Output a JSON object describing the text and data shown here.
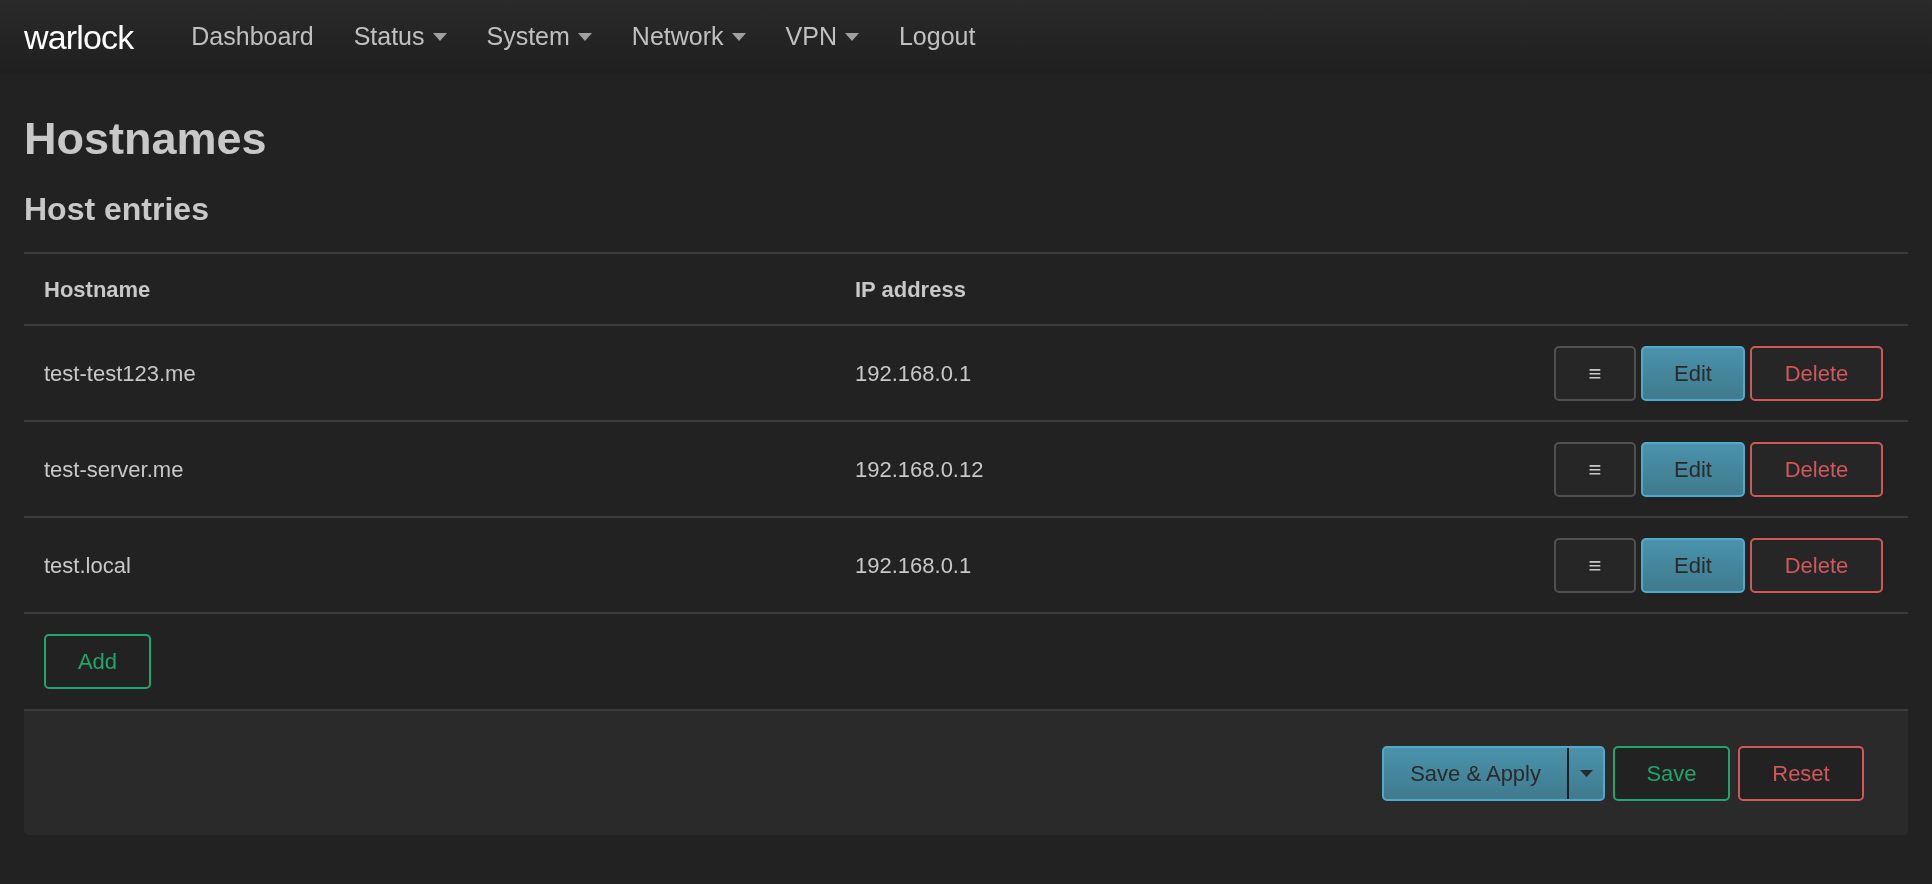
{
  "navbar": {
    "brand": "warlock",
    "items": [
      {
        "label": "Dashboard",
        "dropdown": false
      },
      {
        "label": "Status",
        "dropdown": true
      },
      {
        "label": "System",
        "dropdown": true
      },
      {
        "label": "Network",
        "dropdown": true
      },
      {
        "label": "VPN",
        "dropdown": true
      },
      {
        "label": "Logout",
        "dropdown": false
      }
    ]
  },
  "page_title": "Hostnames",
  "section_title": "Host entries",
  "table": {
    "columns": [
      "Hostname",
      "IP address"
    ],
    "rows": [
      {
        "hostname": "test-test123.me",
        "ip": "192.168.0.1",
        "buttons": [
          {
            "kind": "drag",
            "label": "≡"
          },
          {
            "kind": "edit",
            "label": "Edit"
          },
          {
            "kind": "delete",
            "label": "Delete"
          }
        ]
      },
      {
        "hostname": "test-server.me",
        "ip": "192.168.0.12",
        "buttons": [
          {
            "kind": "drag",
            "label": "≡"
          },
          {
            "kind": "edit",
            "label": "Edit"
          },
          {
            "kind": "delete",
            "label": "Delete"
          }
        ]
      },
      {
        "hostname": "test.local",
        "ip": "192.168.0.1",
        "buttons": [
          {
            "kind": "drag",
            "label": "≡"
          },
          {
            "kind": "edit",
            "label": "Edit"
          },
          {
            "kind": "delete",
            "label": "Delete"
          }
        ]
      }
    ]
  },
  "add_button": "Add",
  "footer_buttons": [
    {
      "kind": "apply",
      "label": "Save & Apply"
    },
    {
      "kind": "save",
      "label": "Save"
    },
    {
      "kind": "reset",
      "label": "Reset"
    }
  ]
}
